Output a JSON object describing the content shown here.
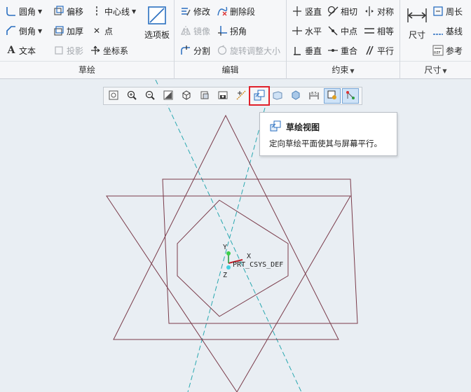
{
  "ribbon": {
    "groups": {
      "sketch": {
        "label": "草绘"
      },
      "edit": {
        "label": "编辑"
      },
      "constraint": {
        "label": "约束"
      },
      "dimension": {
        "label": "尺寸"
      }
    },
    "sketch": {
      "fillet": "圆角",
      "chamfer": "倒角",
      "text": "文本",
      "offset": "偏移",
      "thicken": "加厚",
      "project": "投影",
      "centerline": "中心线",
      "point": "点",
      "csys": "坐标系",
      "palette": "选项板"
    },
    "edit": {
      "modify": "修改",
      "delete_segment": "删除段",
      "mirror": "镜像",
      "corner": "拐角",
      "divide": "分割",
      "rotate_resize": "旋转调整大小"
    },
    "constraint": {
      "vertical": "竖直",
      "horizontal": "水平",
      "perpendicular": "垂直",
      "tangent": "相切",
      "midpoint": "中点",
      "coincident": "重合",
      "symmetric": "对称",
      "equal": "相等",
      "parallel": "平行"
    },
    "dimension": {
      "dimension": "尺寸",
      "perimeter": "周长",
      "baseline": "基线",
      "reference": "参考"
    }
  },
  "tooltip": {
    "title": "草绘视图",
    "description": "定向草绘平面使其与屏幕平行。"
  },
  "canvas": {
    "csys_label": "PRT_CSYS_DEF",
    "axis_x": "X",
    "axis_y": "Y",
    "axis_z": "Z"
  },
  "colors": {
    "sketch_line": "#7a3b4a",
    "centerline": "#2aa8b0",
    "highlight": "#e0202a",
    "active_button": "#cfe3f7"
  }
}
